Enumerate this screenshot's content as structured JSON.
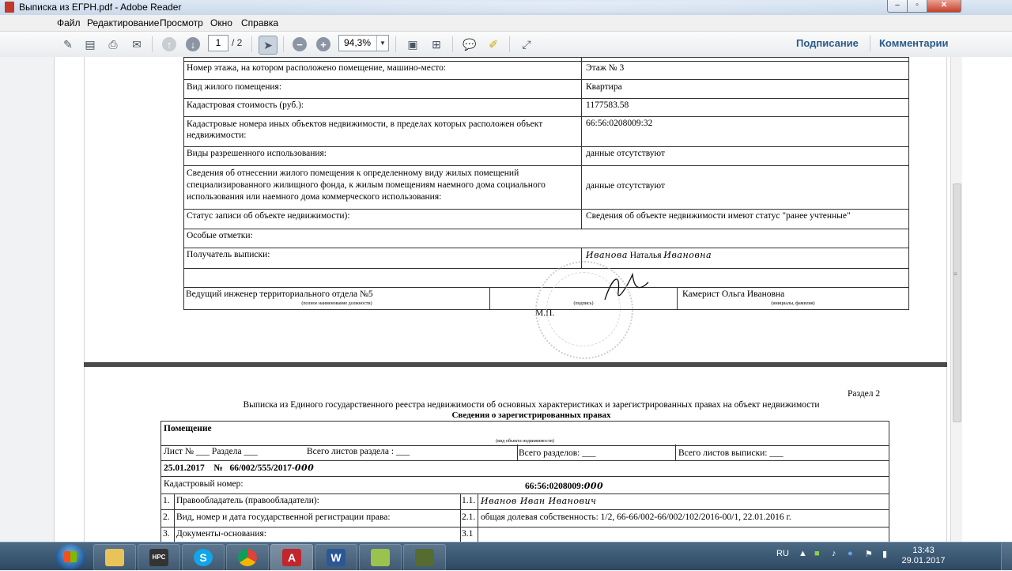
{
  "window": {
    "title": "Выписка из ЕГРН.pdf - Adobe Reader"
  },
  "menu": [
    "Файл",
    "Редактирование",
    "Просмотр",
    "Окно",
    "Справка"
  ],
  "toolbar": {
    "page_current": "1",
    "page_total": "/ 2",
    "zoom": "94,3%",
    "sign_label": "Подписание",
    "comment_label": "Комментарии"
  },
  "page1": {
    "rows": [
      {
        "label": "Номер этажа, на котором расположено помещение, машино-место:",
        "value": "Этаж № 3"
      },
      {
        "label": "Вид жилого помещения:",
        "value": "Квартира"
      },
      {
        "label": "Кадастровая стоимость (руб.):",
        "value": "1177583.58"
      },
      {
        "label": "Кадастровые номера иных объектов недвижимости, в пределах которых расположен объект недвижимости:",
        "value": "66:56:0208009:32"
      },
      {
        "label": "Виды разрешенного использования:",
        "value": "данные отсутствуют"
      },
      {
        "label": "Сведения об отнесении жилого помещения к определенному виду жилых помещений специализированного жилищного фонда, к жилым помещениям наемного дома социального использования или наемного дома коммерческого использования:",
        "value": "данные отсутствуют"
      },
      {
        "label": "Статус записи об объекте недвижимости):",
        "value": "Сведения об объекте недвижимости имеют статус \"ранее учтенные\""
      },
      {
        "label": "Особые отметки:",
        "value": ""
      }
    ],
    "recipient_label": "Получатель выписки:",
    "recipient_surname": "Иванова",
    "recipient_name": "Наталья",
    "recipient_patronymic": "Ивановна",
    "position": "Ведущий инженер территориального отдела №5",
    "position_caption": "(полное наименование должности)",
    "signature_caption": "(подпись)",
    "official_name": "Камерист Ольга Ивановна",
    "name_caption": "(инициалы, фамилия)",
    "stamp_place": "М.П."
  },
  "page2": {
    "section": "Раздел 2",
    "heading": "Выписка из Единого государственного реестра недвижимости об основных характеристиках и зарегистрированных правах на объект недвижимости",
    "subheading": "Сведения о зарегистрированных правах",
    "object_type": "Помещение",
    "object_caption": "(вид объекта недвижимости)",
    "sheet_no": "Лист № ___ Раздела ___",
    "sheets_section": "Всего листов раздела : ___",
    "sections_total": "Всего разделов: ___",
    "sheets_total": "Всего листов выписки: ___",
    "date": "25.01.2017",
    "number_sign": "№",
    "number": "66/002/555/2017-",
    "number_hand": "000",
    "cadastral_label": "Кадастровый номер:",
    "cadastral_value": "66:56:0208009:",
    "cadastral_hand": "000",
    "items": [
      {
        "no": "1.",
        "label": "Правообладатель (правообладатели):",
        "sub": "1.1.",
        "value": "Иванов Иван  Иванович"
      },
      {
        "no": "2.",
        "label": "Вид, номер и дата государственной регистрации права:",
        "sub": "2.1.",
        "value": "общая долевая собственность: 1/2, 66-66/002-66/002/102/2016-00/1, 22.01.2016 г."
      },
      {
        "no": "3.",
        "label": "Документы-основания:",
        "sub": "3.1",
        "value": ""
      }
    ]
  },
  "taskbar": {
    "lang": "RU",
    "time": "13:43",
    "date": "29.01.2017",
    "apps": [
      "explorer",
      "video",
      "skype",
      "chrome",
      "acrobat",
      "word",
      "notes",
      "other"
    ]
  }
}
